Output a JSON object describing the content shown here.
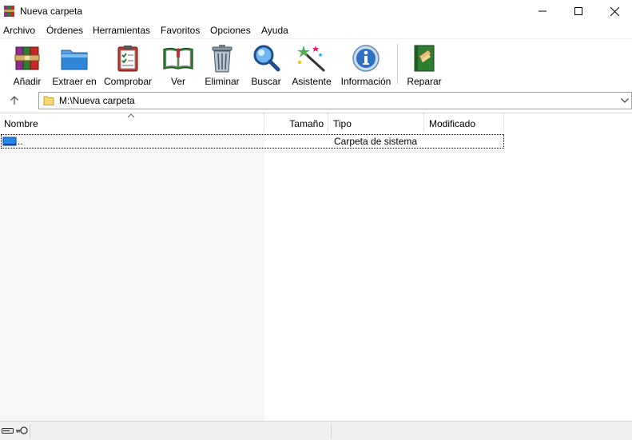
{
  "window": {
    "title": "Nueva carpeta",
    "icon": "winrar-books-icon"
  },
  "menu": [
    "Archivo",
    "Órdenes",
    "Herramientas",
    "Favoritos",
    "Opciones",
    "Ayuda"
  ],
  "toolbar": {
    "add": "Añadir",
    "extract": "Extraer en",
    "test": "Comprobar",
    "view": "Ver",
    "delete": "Eliminar",
    "find": "Buscar",
    "wizard": "Asistente",
    "info": "Información",
    "repair": "Reparar"
  },
  "address": {
    "path": "M:\\Nueva carpeta"
  },
  "columns": {
    "name": "Nombre",
    "size": "Tamaño",
    "type": "Tipo",
    "modified": "Modificado"
  },
  "rows": [
    {
      "name": "..",
      "size": "",
      "type": "Carpeta de sistema",
      "modified": ""
    }
  ],
  "status": {
    "left": "",
    "right": ""
  },
  "colors": {
    "title_bg": "#ffffff",
    "name_col_bg": "#f7f7f7",
    "status_bg": "#f0f0f0",
    "folder_yellow": "#f8d775",
    "row_icon_blue": "#1e88e5"
  }
}
